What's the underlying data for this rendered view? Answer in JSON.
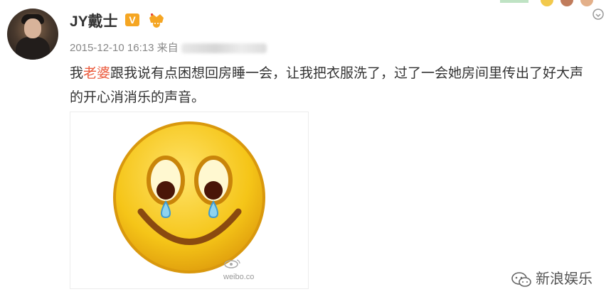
{
  "post": {
    "username": "JY戴士",
    "verified_badge": "V",
    "timestamp": "2015-12-10 16:13",
    "source_prefix": "来自",
    "text_before": "我",
    "text_highlight": "老婆",
    "text_after": "跟我说有点困想回房睡一会，让我把衣服洗了，过了一会她房间里传出了好大声的开心消消乐的声音。",
    "image_watermark": "weibo.co",
    "footer_source": "新浪娱乐"
  },
  "colors": {
    "highlight": "#eb5a3c",
    "badge": "#f5a623",
    "emoji_face": "#f5c518"
  },
  "icons": [
    "avatar",
    "verified-v-icon",
    "crown-icon",
    "smiley-crying-emoji",
    "weibo-logo-icon",
    "wechat-icon"
  ]
}
